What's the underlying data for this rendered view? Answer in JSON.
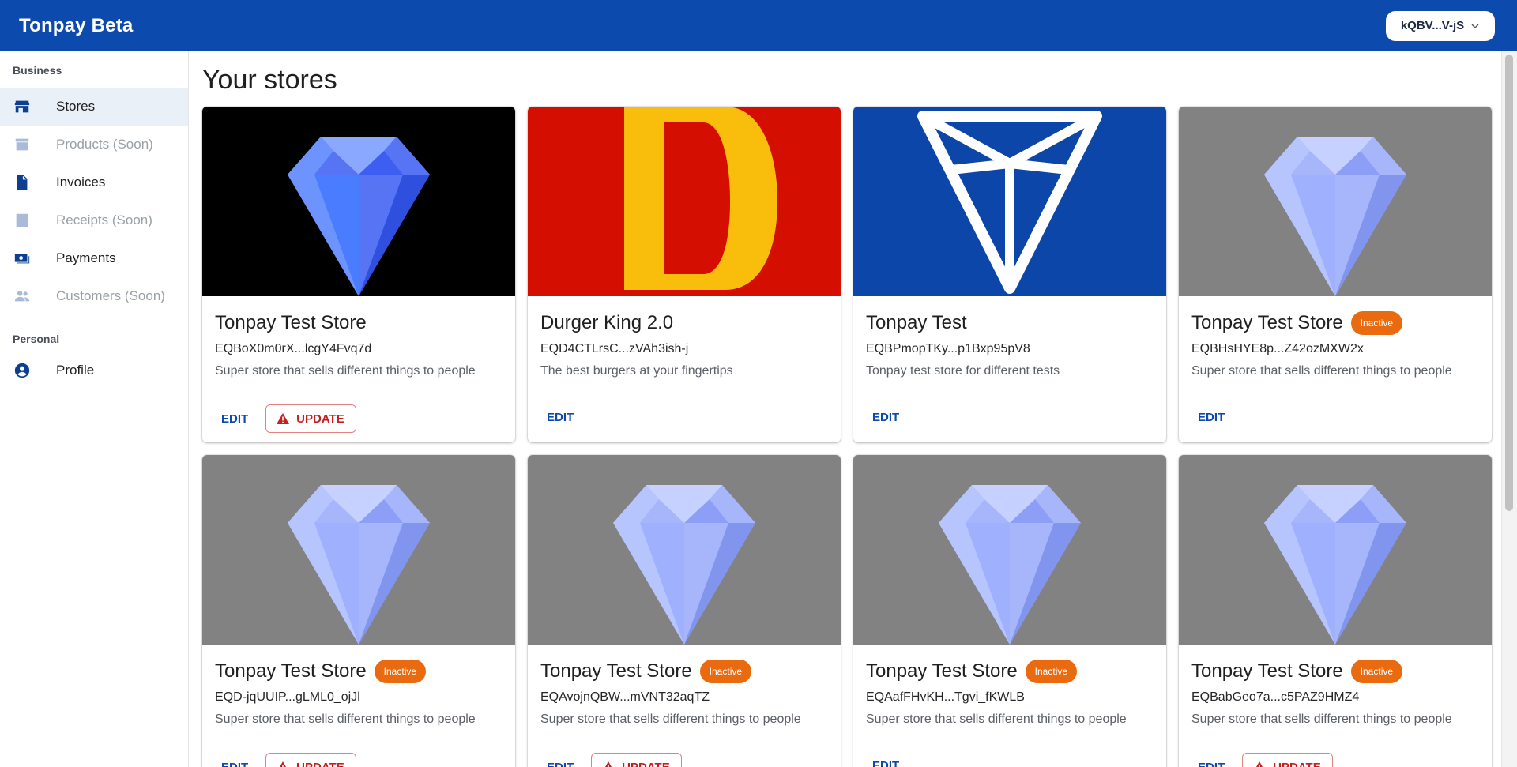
{
  "app": {
    "title": "Tonpay Beta"
  },
  "wallet": {
    "label": "kQBV...V-jS"
  },
  "sidebar": {
    "business_label": "Business",
    "personal_label": "Personal",
    "items": [
      {
        "label": "Stores",
        "icon": "store-icon"
      },
      {
        "label": "Products (Soon)",
        "icon": "archive-icon"
      },
      {
        "label": "Invoices",
        "icon": "document-icon"
      },
      {
        "label": "Receipts (Soon)",
        "icon": "receipt-icon"
      },
      {
        "label": "Payments",
        "icon": "payments-icon"
      },
      {
        "label": "Customers (Soon)",
        "icon": "users-icon"
      }
    ],
    "profile": {
      "label": "Profile",
      "icon": "user-circle-icon"
    }
  },
  "main": {
    "title": "Your stores",
    "edit_label": "EDIT",
    "update_label": "UPDATE",
    "inactive_label": "Inactive",
    "stores": [
      {
        "name": "Tonpay Test Store",
        "address": "EQBoX0m0rX...lcgY4Fvq7d",
        "description": "Super store that sells different things to people",
        "image": "diamond-black",
        "inactive": false,
        "update": true
      },
      {
        "name": "Durger King 2.0",
        "address": "EQD4CTLrsC...zVAh3ish-j",
        "description": "The best burgers at your fingertips",
        "image": "letter-d",
        "inactive": false,
        "update": false
      },
      {
        "name": "Tonpay Test",
        "address": "EQBPmopTKy...p1Bxp95pV8",
        "description": "Tonpay test store for different tests",
        "image": "ton-logo",
        "inactive": false,
        "update": false
      },
      {
        "name": "Tonpay Test Store",
        "address": "EQBHsHYE8p...Z42ozMXW2x",
        "description": "Super store that sells different things to people",
        "image": "diamond-gray",
        "inactive": true,
        "update": false
      },
      {
        "name": "Tonpay Test Store",
        "address": "EQD-jqUUIP...gLML0_ojJl",
        "description": "Super store that sells different things to people",
        "image": "diamond-gray",
        "inactive": true,
        "update": true
      },
      {
        "name": "Tonpay Test Store",
        "address": "EQAvojnQBW...mVNT32aqTZ",
        "description": "Super store that sells different things to people",
        "image": "diamond-gray",
        "inactive": true,
        "update": true
      },
      {
        "name": "Tonpay Test Store",
        "address": "EQAafFHvKH...Tgvi_fKWLB",
        "description": "Super store that sells different things to people",
        "image": "diamond-gray",
        "inactive": true,
        "update": false
      },
      {
        "name": "Tonpay Test Store",
        "address": "EQBabGeo7a...c5PAZ9HMZ4",
        "description": "Super store that sells different things to people",
        "image": "diamond-gray",
        "inactive": true,
        "update": true
      }
    ]
  },
  "colors": {
    "header": "#0c4aad",
    "badge": "#ea6a10",
    "update": "#c42020"
  }
}
